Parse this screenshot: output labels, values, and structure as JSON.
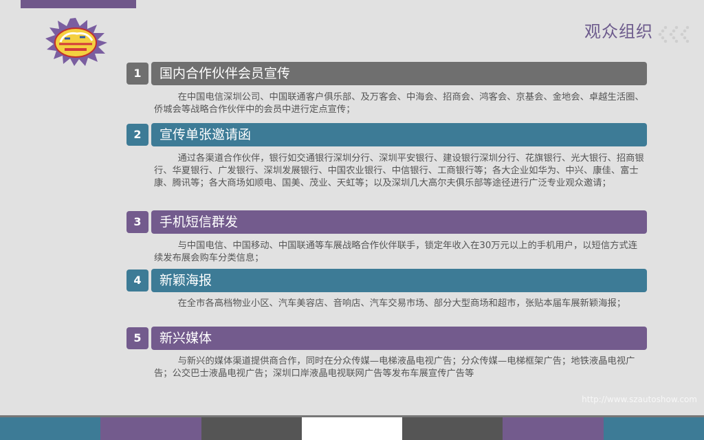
{
  "header": {
    "title": "观众组织",
    "logo_icon": "auto-show-logo-icon",
    "deco_icon": "chevrons-left-icon"
  },
  "sections": [
    {
      "number": "1",
      "title": "国内合作伙伴会员宣传",
      "body": "在中国电信深圳公司、中国联通客户俱乐部、及万客会、中海会、招商会、鸿客会、京基会、金地会、卓越生活圈、侨城会等战略合作伙伴中的会员中进行定点宣传；",
      "color": "#6f6f6f"
    },
    {
      "number": "2",
      "title": "宣传单张邀请函",
      "body": "通过各渠道合作伙伴，银行如交通银行深圳分行、深圳平安银行、建设银行深圳分行、花旗银行、光大银行、招商银行、华夏银行、广发银行、深圳发展银行、中国农业银行、中信银行、工商银行等；各大企业如华为、中兴、康佳、富士康、腾讯等；各大商场如顺电、国美、茂业、天虹等；以及深圳几大高尔夫俱乐部等途径进行广泛专业观众邀请；",
      "color": "#3d7b96"
    },
    {
      "number": "3",
      "title": "手机短信群发",
      "body": "与中国电信、中国移动、中国联通等车展战略合作伙伴联手，锁定年收入在30万元以上的手机用户，以短信方式连续发布展会购车分类信息；",
      "color": "#735b8d"
    },
    {
      "number": "4",
      "title": "新颖海报",
      "body": "在全市各高档物业小区、汽车美容店、音响店、汽车交易市场、部分大型商场和超市，张贴本届车展新颖海报；",
      "color": "#3d7b96"
    },
    {
      "number": "5",
      "title": "新兴媒体",
      "body": "与新兴的媒体渠道提供商合作，同时在分众传媒—电梯液晶电视广告；分众传媒—电梯框架广告；地铁液晶电视广告；公交巴士液晶电视广告；深圳口岸液晶电视联网广告等发布车展宣传广告等",
      "color": "#735b8d"
    }
  ],
  "footer": {
    "url": "http://www.szautoshow.com",
    "stripe_colors": [
      "#3d7b96",
      "#735b8d",
      "#555555",
      "#ffffff",
      "#555555",
      "#735b8d",
      "#3d7b96"
    ]
  }
}
